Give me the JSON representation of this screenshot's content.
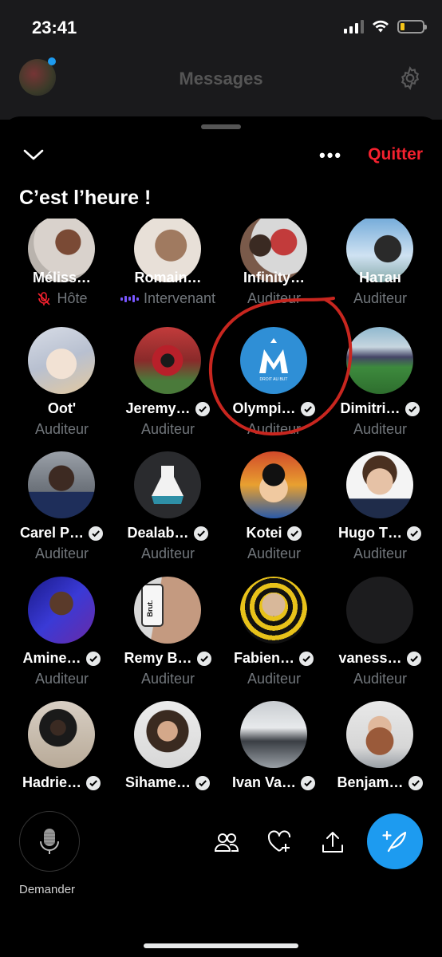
{
  "status": {
    "time": "23:41"
  },
  "header": {
    "title": "Messages"
  },
  "sheet": {
    "title": "C’est l’heure !",
    "more_label": "•••",
    "quit_label": "Quitter"
  },
  "colors": {
    "accent": "#1d9bf0",
    "danger": "#f4212e",
    "speaker_wave": "#7856ff",
    "secondary_text": "#71767b"
  },
  "participants": [
    {
      "name": "Méliss…",
      "role": "Hôte",
      "verified": false,
      "role_icon": "mic-off-icon"
    },
    {
      "name": "Romain…",
      "role": "Intervenant",
      "verified": false,
      "role_icon": "sound-wave-icon"
    },
    {
      "name": "Infinity…",
      "role": "Auditeur",
      "verified": false
    },
    {
      "name": "Натан",
      "role": "Auditeur",
      "verified": false
    },
    {
      "name": "Oot'",
      "role": "Auditeur",
      "verified": false
    },
    {
      "name": "Jeremy…",
      "role": "Auditeur",
      "verified": true
    },
    {
      "name": "Olympi…",
      "role": "Auditeur",
      "verified": true,
      "highlighted": true,
      "avatar_text": "DROIT AU BUT"
    },
    {
      "name": "Dimitri…",
      "role": "Auditeur",
      "verified": true
    },
    {
      "name": "Carel P…",
      "role": "Auditeur",
      "verified": true
    },
    {
      "name": "Dealab…",
      "role": "Auditeur",
      "verified": true
    },
    {
      "name": "Kotei",
      "role": "Auditeur",
      "verified": true
    },
    {
      "name": "Hugo T…",
      "role": "Auditeur",
      "verified": true
    },
    {
      "name": "Amine…",
      "role": "Auditeur",
      "verified": true
    },
    {
      "name": "Remy B…",
      "role": "Auditeur",
      "verified": true,
      "avatar_text": "Brut."
    },
    {
      "name": "Fabien…",
      "role": "Auditeur",
      "verified": true
    },
    {
      "name": "vaness…",
      "role": "Auditeur",
      "verified": true
    },
    {
      "name": "Hadrie…",
      "role": "",
      "verified": true
    },
    {
      "name": "Sihame…",
      "role": "",
      "verified": true
    },
    {
      "name": "Ivan Va…",
      "role": "",
      "verified": true
    },
    {
      "name": "Benjam…",
      "role": "",
      "verified": true
    }
  ],
  "bottom_bar": {
    "request_label": "Demander",
    "icons": [
      "people-icon",
      "heart-plus-icon",
      "share-icon",
      "compose-icon"
    ]
  }
}
